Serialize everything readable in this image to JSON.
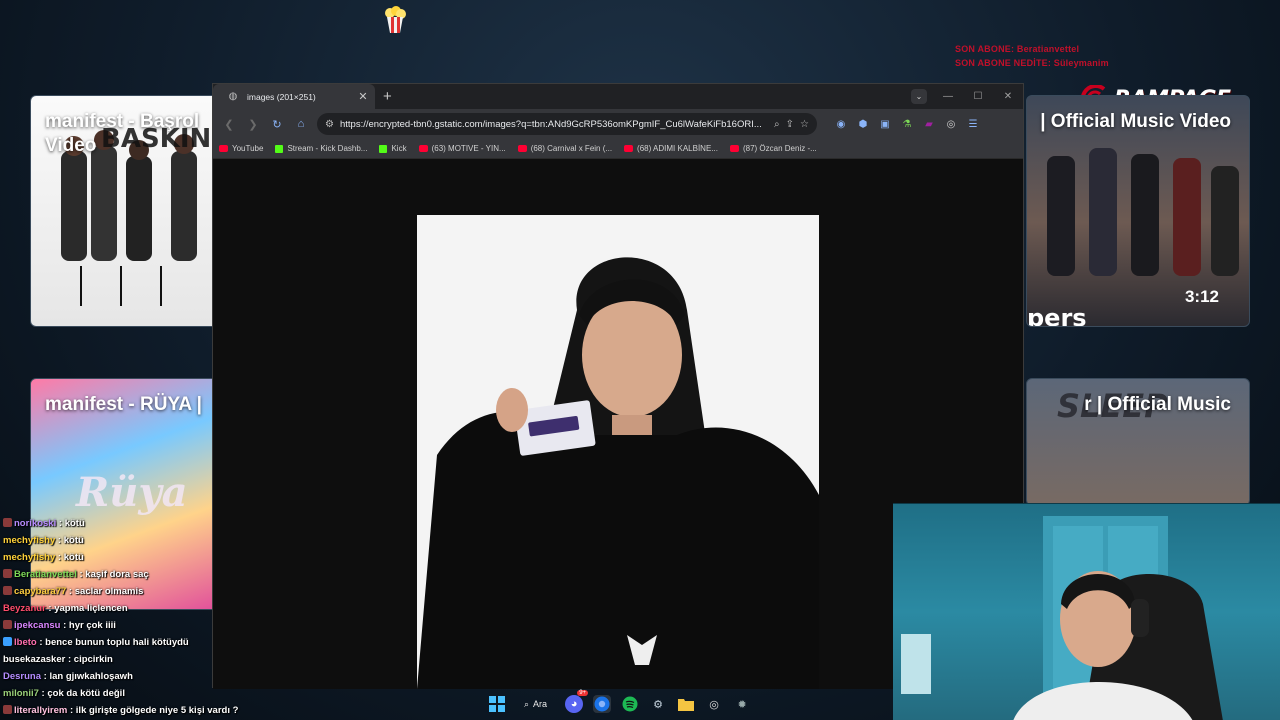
{
  "overlay": {
    "sub_alert_line1": "SON ABONE: Beratianvettel",
    "sub_alert_line2": "SON ABONE NEDİTE: Süleymanim",
    "brand": "RAMPAGE",
    "brand_color": "#c8001e"
  },
  "cards": [
    {
      "title": "manifest - Başrol\nVideo",
      "watermark": "BASKIN"
    },
    {
      "title": "manifest - RÜYA |",
      "watermark": "Rüya"
    },
    {
      "title": "| Official Music Video",
      "duration": "3:12",
      "watermark": "pers"
    },
    {
      "title": "r | Official Music",
      "watermark": "SLEEP"
    }
  ],
  "browser": {
    "tab_title": "images (201×251)",
    "url": "https://encrypted-tbn0.gstatic.com/images?q=tbn:ANd9GcRP536omKPgmIF_Cu6lWafeKiFb16ORI...",
    "bookmarks": [
      {
        "label": "YouTube",
        "icon": "youtube-icon"
      },
      {
        "label": "Stream - Kick Dashb...",
        "icon": "kick-icon"
      },
      {
        "label": "Kick",
        "icon": "kick-icon"
      },
      {
        "label": "(63) MOTIVE - YIN...",
        "icon": "youtube-icon"
      },
      {
        "label": "(68) Carnival x Fein (...",
        "icon": "youtube-icon"
      },
      {
        "label": "(68) ADIMI KALBİNE...",
        "icon": "youtube-icon"
      },
      {
        "label": "(87) Özcan Deniz -...",
        "icon": "youtube-icon"
      }
    ]
  },
  "chat": [
    {
      "user": "norikoski",
      "msg": "kötü",
      "color": "#b78cff",
      "badge": "#8a3a3a"
    },
    {
      "user": "mechyfishy",
      "msg": "kötü",
      "color": "#ffd23a",
      "badge": ""
    },
    {
      "user": "mechyfishy",
      "msg": "kötü",
      "color": "#ffd23a",
      "badge": ""
    },
    {
      "user": "Beratianvettel",
      "msg": "kaşif dora saç",
      "color": "#7dd957",
      "badge": "#8a3a3a"
    },
    {
      "user": "capybara77",
      "msg": "saclar olmamis",
      "color": "#ffcf40",
      "badge": "#8a3a3a"
    },
    {
      "user": "Beyzanur",
      "msg": "yapma liçlencen",
      "color": "#ff4d6d",
      "badge": ""
    },
    {
      "user": "ipekcansu",
      "msg": "hyr çok iiii",
      "color": "#d986ff",
      "badge": "#8a3a3a"
    },
    {
      "user": "lbeto",
      "msg": "bence bunun toplu hali kötüydü",
      "color": "#ff6fb0",
      "badge": "#3aa0ff"
    },
    {
      "user": "busekazasker",
      "msg": "cipcirkin",
      "color": "#ffffff",
      "badge": ""
    },
    {
      "user": "Desruna",
      "msg": "lan gjıwkahloşawh",
      "color": "#b38cff",
      "badge": ""
    },
    {
      "user": "milonii7",
      "msg": "çok da kötü değil",
      "color": "#9ad17a",
      "badge": ""
    },
    {
      "user": "literallyirem",
      "msg": "ilk girişte gölgede niye 5 kişi vardı ?",
      "color": "#ffc2e0",
      "badge": "#8a3a3a"
    }
  ],
  "taskbar": {
    "search_label": "Ara",
    "icons": [
      "windows-start-icon",
      "discord-icon",
      "chrome-icon",
      "spotify-icon",
      "steam-icon",
      "file-explorer-icon",
      "obs-icon",
      "settings-icon"
    ],
    "discord_badge": "9+"
  }
}
